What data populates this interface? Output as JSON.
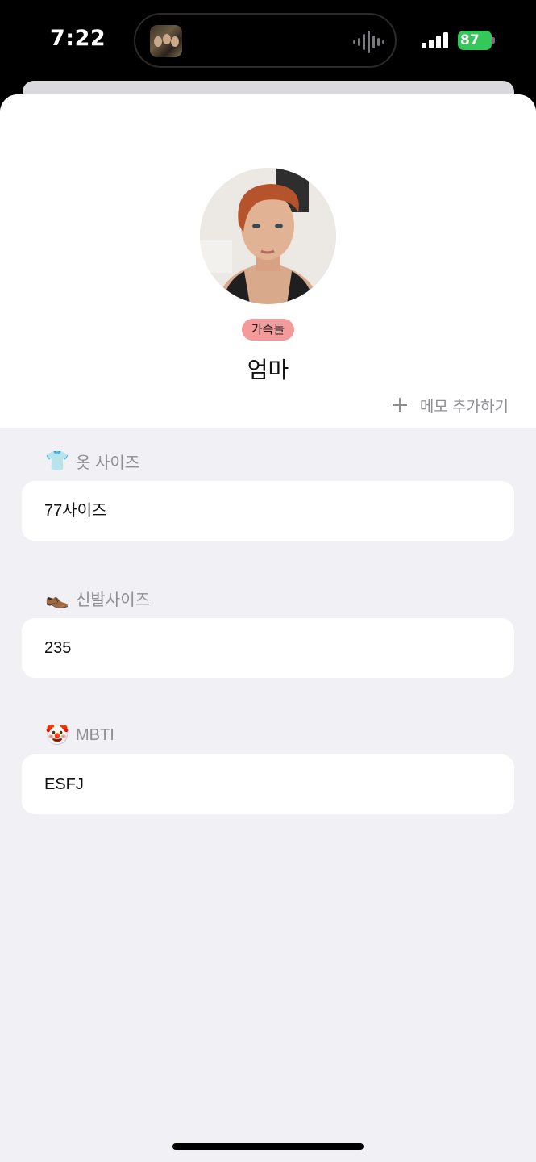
{
  "status_bar": {
    "time": "7:22",
    "battery": "87",
    "battery_color": "#34c759",
    "icons": [
      "album-art-icon",
      "waveform-icon",
      "signal-icon",
      "battery-icon"
    ]
  },
  "profile": {
    "tag": "가족들",
    "tag_color": "#f59a9b",
    "name": "엄마",
    "memo_label": "메모 추가하기"
  },
  "fields": [
    {
      "icon": "shirt-icon",
      "emoji": "👕",
      "label": "옷 사이즈",
      "value": "77사이즈"
    },
    {
      "icon": "shoe-icon",
      "emoji": "👞",
      "label": "신발사이즈",
      "value": "235"
    },
    {
      "icon": "clown-icon",
      "emoji": "🤡",
      "label": "MBTI",
      "value": "ESFJ"
    }
  ]
}
